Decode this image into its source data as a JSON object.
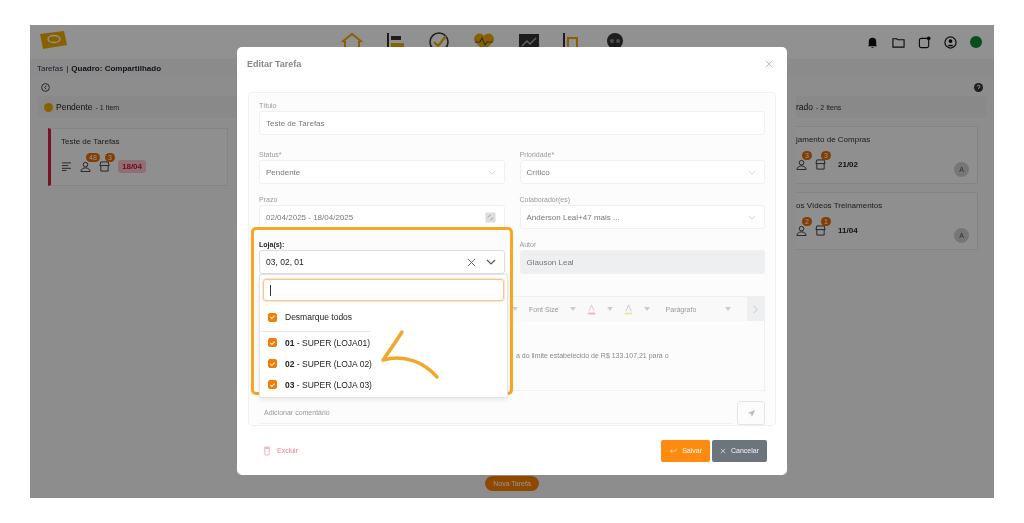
{
  "breadcrumb": {
    "section": "Tarefas",
    "separator": "|",
    "board": "Quadro: Compartilhado"
  },
  "columns": [
    {
      "title": "Pendente",
      "count": "- 1 Item",
      "cards": [
        {
          "title": "Teste de Tarefas",
          "assignees": "48",
          "stores": "3",
          "due": "18/04",
          "overdue": true
        }
      ]
    },
    {
      "title": "rado",
      "count": "- 2 Itens",
      "cards": [
        {
          "title": "jamento de Compras",
          "assignees": "3",
          "stores": "3",
          "due": "21/02",
          "overdue": false,
          "avatar": "A"
        },
        {
          "title": "os Vídeos Treinamentos",
          "assignees": "2",
          "stores": "1",
          "due": "11/04",
          "overdue": false,
          "avatar": "A"
        }
      ]
    }
  ],
  "new_task_button": "Nova Tarefa",
  "modal": {
    "title": "Editar Tarefa",
    "title_field": {
      "label": "Título",
      "value": "Teste de Tarefas"
    },
    "fields": [
      {
        "kind": "select",
        "label": "Status*",
        "value": "Pendente"
      },
      {
        "kind": "select",
        "label": "Prioridade*",
        "value": "Crítico"
      },
      {
        "kind": "date",
        "label": "Prazo",
        "value": "02/04/2025 - 18/04/2025"
      },
      {
        "kind": "select",
        "label": "Colaborador(es)",
        "value": "Anderson Leal+47 mais ..."
      },
      {
        "kind": "multiselect",
        "label": "Loja(s):",
        "value": "03, 02, 01",
        "expanded": true
      },
      {
        "kind": "readonly",
        "label": "Autor",
        "value": "Glauson Leal"
      }
    ],
    "dropdown": {
      "toggle_all": {
        "label": "Desmarque todos",
        "checked": true
      },
      "options": [
        {
          "label": "**01** - SUPER (LOJA01)",
          "checked": true
        },
        {
          "label": "**02** - SUPER (LOJA 02)",
          "checked": true
        },
        {
          "label": "**03** - SUPER (LOJA 03)",
          "checked": true
        }
      ]
    },
    "editor": {
      "font_size": "Font Size",
      "paragraph": "Parágrafo",
      "text": "a do limite estabelecido de R$ 133.107,21 para o"
    },
    "comment": {
      "placeholder": "Adicionar comentário"
    },
    "delete_button": "Excluir",
    "save_button": "Salvar",
    "cancel_button": "Cancelar"
  }
}
